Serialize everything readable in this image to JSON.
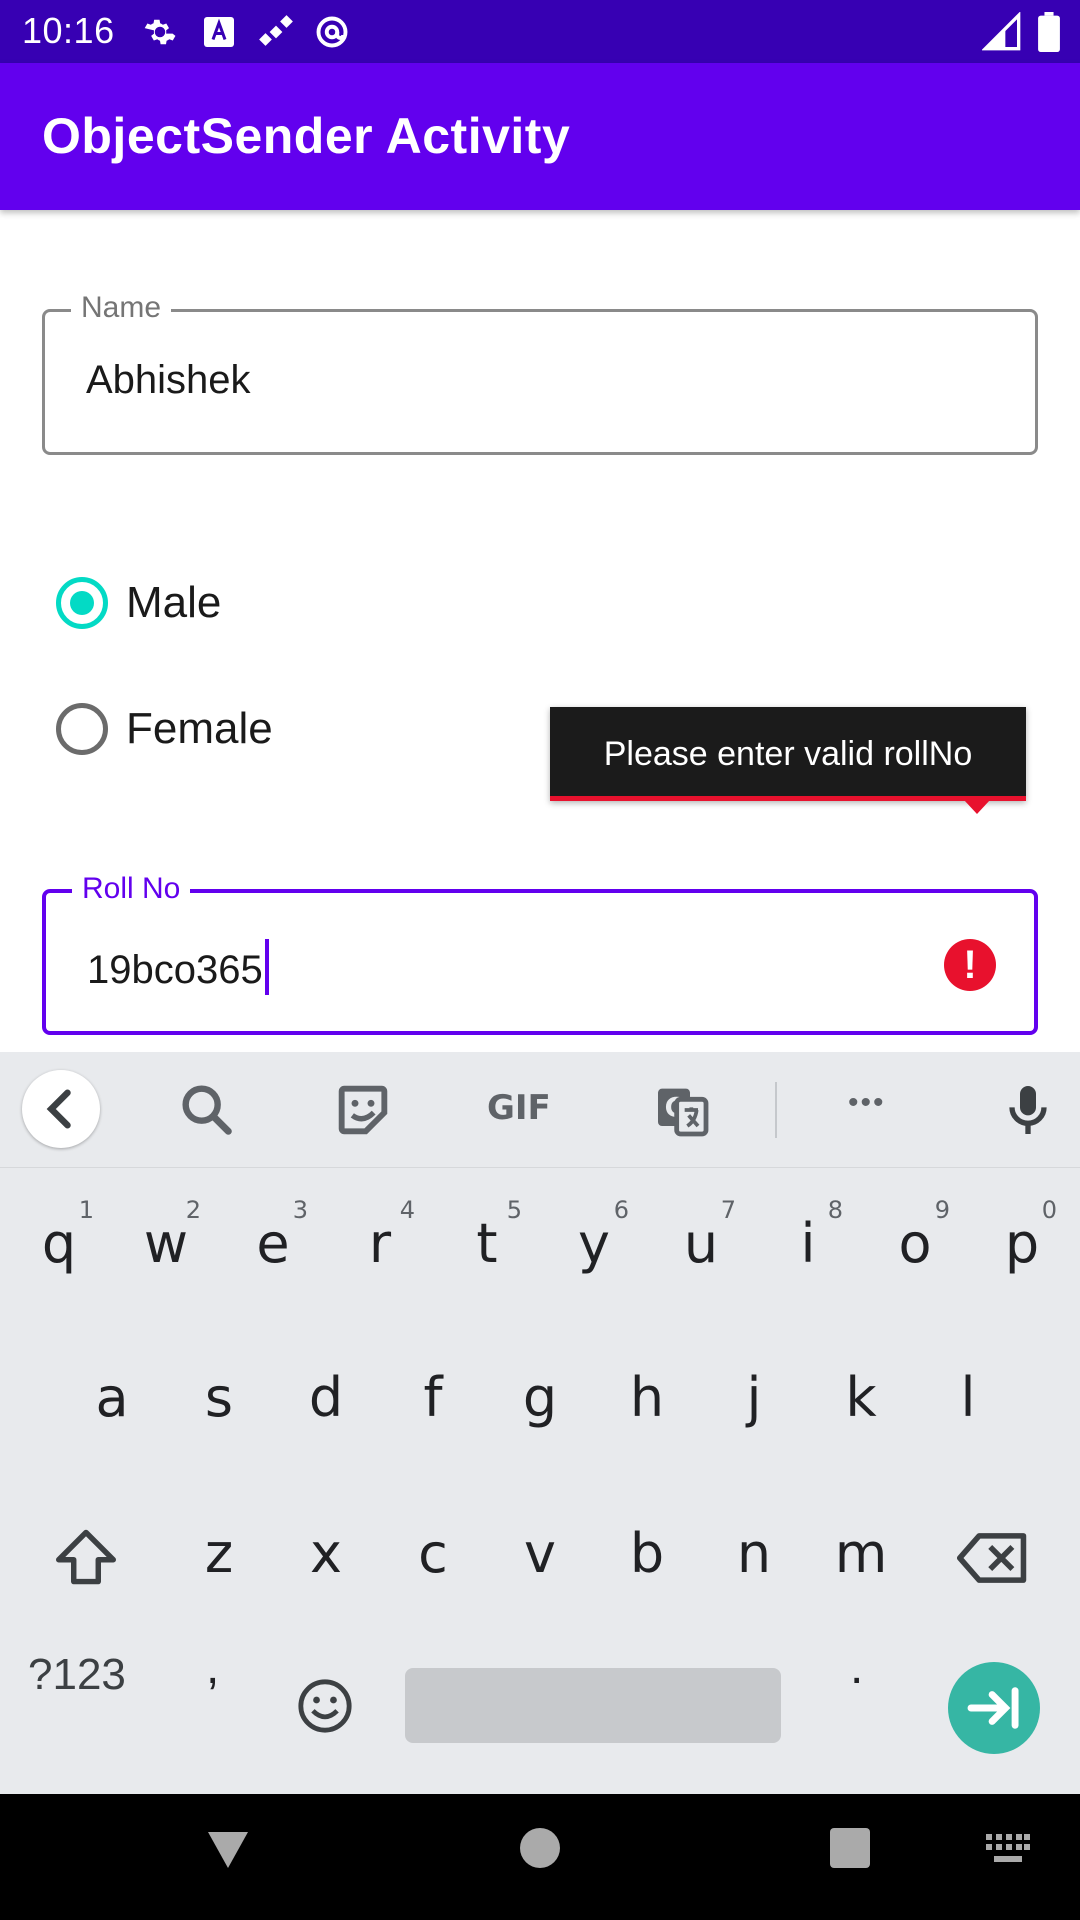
{
  "status_bar": {
    "time": "10:16",
    "left_icons": [
      "settings-icon",
      "translate-a-icon",
      "satellite-icon",
      "at-sign-icon"
    ],
    "right_icons": [
      "cellular-signal-icon",
      "battery-icon"
    ]
  },
  "app_bar": {
    "title": "ObjectSender Activity"
  },
  "form": {
    "name_label": "Name",
    "name_value": "Abhishek",
    "gender_options": [
      {
        "label": "Male",
        "selected": true
      },
      {
        "label": "Female",
        "selected": false
      }
    ],
    "roll_label": "Roll No",
    "roll_value": "19bco365",
    "error_tooltip": "Please enter valid rollNo",
    "error_icon_glyph": "!"
  },
  "keyboard": {
    "toolbar_icons": [
      "back-chevron-icon",
      "search-icon",
      "sticker-icon",
      "gif-icon",
      "translate-icon",
      "more-icon",
      "microphone-icon"
    ],
    "gif_label": "GIF",
    "more_label": "•••",
    "row1": [
      {
        "ch": "q",
        "hint": "1"
      },
      {
        "ch": "w",
        "hint": "2"
      },
      {
        "ch": "e",
        "hint": "3"
      },
      {
        "ch": "r",
        "hint": "4"
      },
      {
        "ch": "t",
        "hint": "5"
      },
      {
        "ch": "y",
        "hint": "6"
      },
      {
        "ch": "u",
        "hint": "7"
      },
      {
        "ch": "i",
        "hint": "8"
      },
      {
        "ch": "o",
        "hint": "9"
      },
      {
        "ch": "p",
        "hint": "0"
      }
    ],
    "row2": [
      "a",
      "s",
      "d",
      "f",
      "g",
      "h",
      "j",
      "k",
      "l"
    ],
    "row3": [
      "z",
      "x",
      "c",
      "v",
      "b",
      "n",
      "m"
    ],
    "symbols_label": "?123",
    "comma": ",",
    "period": ".",
    "accent_color": "#36b6a4"
  },
  "colors": {
    "primary": "#6200ee",
    "primary_dark": "#3700b3",
    "radio_accent": "#03dac5",
    "error": "#e8112d"
  }
}
